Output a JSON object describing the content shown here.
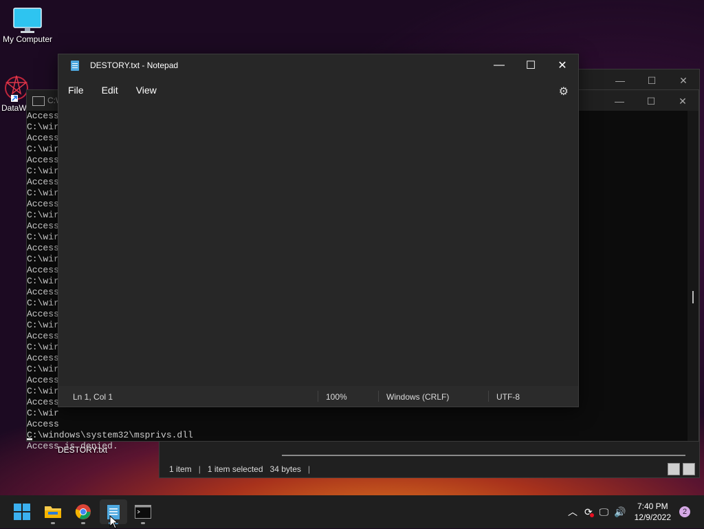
{
  "desktop": {
    "icons": [
      {
        "label": "My Computer"
      },
      {
        "label": "DataW"
      }
    ],
    "file_label": "DESTORY.txt"
  },
  "explorer": {
    "status_items": "1 item",
    "status_selected": "1 item selected",
    "status_size": "34 bytes"
  },
  "cmd": {
    "title": "C:\\",
    "lines": "Access\nC:\\wir\nAccess\nC:\\wir\nAccess\nC:\\wir\nAccess\nC:\\wir\nAccess\nC:\\wir\nAccess\nC:\\wir\nAccess\nC:\\wir\nAccess\nC:\\wir\nAccess\nC:\\wir\nAccess\nC:\\wir\nAccess\nC:\\wir\nAccess\nC:\\wir\nAccess\nC:\\wir\nAccess\nC:\\wir\nAccess\nC:\\windows\\system32\\msprivs.dll\nAccess is denied."
  },
  "notepad": {
    "title": "DESTORY.txt - Notepad",
    "menu": [
      "File",
      "Edit",
      "View"
    ],
    "status": {
      "position": "Ln 1, Col 1",
      "zoom": "100%",
      "line_ending": "Windows (CRLF)",
      "encoding": "UTF-8"
    }
  },
  "taskbar": {
    "apps": [
      "start",
      "file-explorer",
      "chrome",
      "notepad",
      "terminal"
    ],
    "time": "7:40 PM",
    "date": "12/9/2022",
    "notifications": "2"
  }
}
